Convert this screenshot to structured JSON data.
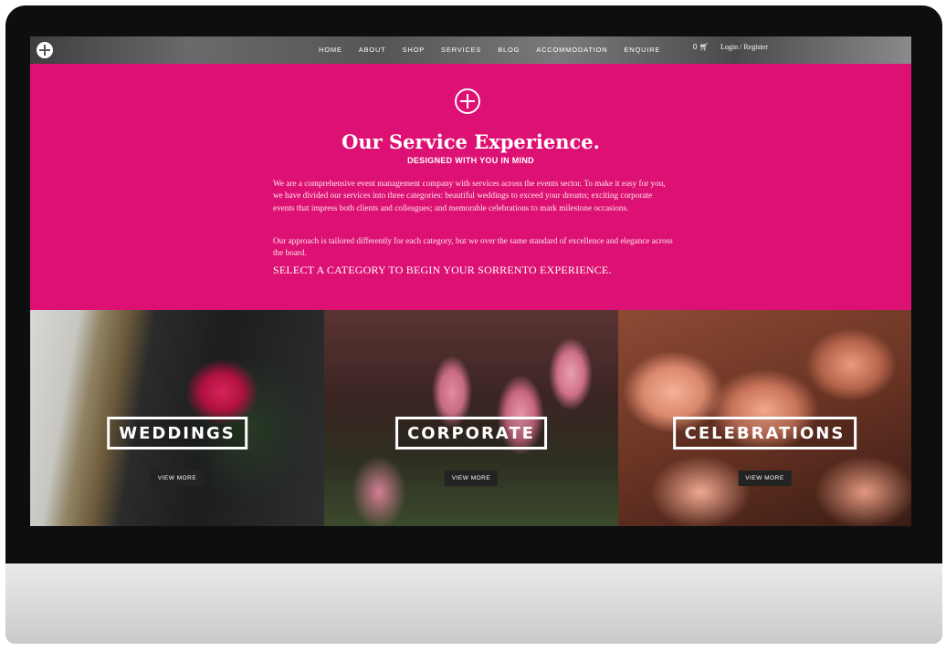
{
  "nav": {
    "items": [
      "HOME",
      "ABOUT",
      "SHOP",
      "SERVICES",
      "BLOG",
      "ACCOMMODATION",
      "ENQUIRE"
    ],
    "cart_count": "0",
    "login": "Login / Register"
  },
  "hero": {
    "title": "Our Service Experience.",
    "subtitle": "DESIGNED WITH YOU IN MIND",
    "paragraph1": "We are a comprehensive event management company with services across the events sector. To make it easy for you, we have divided our services into three categories: beautiful weddings to exceed your dreams; exciting corporate events that impress both clients and colleagues; and memorable celebrations to mark milestone occasions.",
    "paragraph2": "Our approach is tailored differently for each category, but we over the same standard of excellence and elegance across the board.",
    "cta": "SELECT A CATEGORY TO BEGIN YOUR SORRENTO EXPERIENCE."
  },
  "categories": [
    {
      "label": "WEDDINGS",
      "button": "VIEW MORE"
    },
    {
      "label": "CORPORATE",
      "button": "VIEW MORE"
    },
    {
      "label": "CELEBRATIONS",
      "button": "VIEW MORE"
    }
  ],
  "colors": {
    "accent": "#dd1173"
  }
}
